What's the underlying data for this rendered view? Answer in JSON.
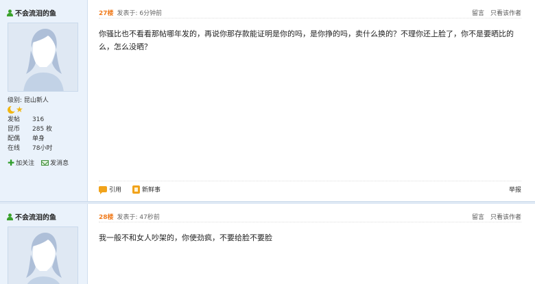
{
  "posts": [
    {
      "user": {
        "name": "不会流泪的鱼",
        "level_label": "级别: 昆山新人",
        "stats": [
          {
            "key": "发帖",
            "value": "316"
          },
          {
            "key": "昆币",
            "value": "285 枚"
          },
          {
            "key": "配偶",
            "value": "单身"
          },
          {
            "key": "在线",
            "value": "78小时"
          }
        ],
        "follow_label": "加关注",
        "message_label": "发消息"
      },
      "floor": "27楼",
      "time": "发表于: 6分钟前",
      "actions": {
        "reply": "留言",
        "only_author": "只看该作者"
      },
      "content": "你骚比也不看看那帖哪年发的，再说你那存款能证明是你的吗，是你挣的吗，卖什么换的？不理你还上脸了，你不是要晒比的么，怎么没晒？",
      "footer": {
        "quote": "引用",
        "new_thing": "新鲜事",
        "report": "举报"
      }
    },
    {
      "user": {
        "name": "不会流泪的鱼"
      },
      "floor": "28楼",
      "time": "发表于: 47秒前",
      "actions": {
        "reply": "留言",
        "only_author": "只看该作者"
      },
      "content": "我一般不和女人吵架的，你使劲疯，不要给脸不要脸"
    }
  ],
  "colors": {
    "sidebar_bg": "#eaf2fb",
    "floor_orange": "#f07c1e",
    "icon_green": "#3aa12c",
    "icon_yellow": "#f1a31b"
  }
}
